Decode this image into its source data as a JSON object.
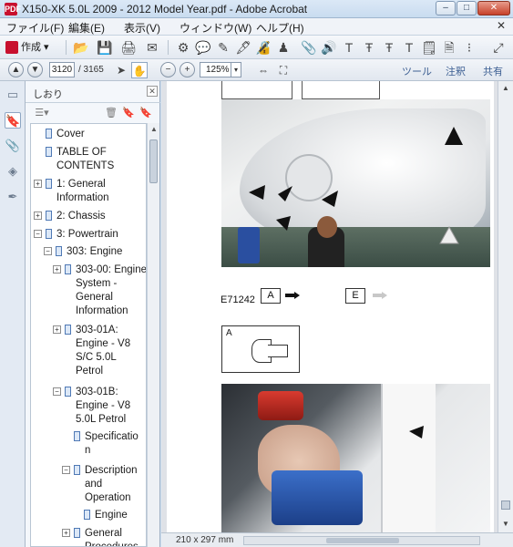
{
  "window": {
    "title": "X150-XK 5.0L 2009 - 2012 Model Year.pdf - Adobe Acrobat",
    "app_icon": "PDF",
    "buttons": {
      "minimize": "–",
      "maximize": "□",
      "close": "✕"
    }
  },
  "menu": {
    "items": [
      "ファイル(F)",
      "編集(E)",
      "表示(V)",
      "ウィンドウ(W)",
      "ヘルプ(H)"
    ],
    "close_glyph": "✕"
  },
  "toolbar": {
    "create_label": "作成 ▾"
  },
  "nav": {
    "current_page": "3120",
    "total_pages": "/ 3165",
    "zoom": "125%",
    "tabs": [
      "ツール",
      "注釈",
      "共有"
    ]
  },
  "bookmarks": {
    "title": "しおり",
    "close": "✕",
    "items": [
      {
        "label": "Cover"
      },
      {
        "label": "TABLE OF CONTENTS"
      },
      {
        "label": "1: General Information"
      },
      {
        "label": "2: Chassis"
      },
      {
        "label": "3: Powertrain"
      },
      {
        "label": "303: Engine"
      },
      {
        "label": "303-00: Engine System - General Information"
      },
      {
        "label": "303-01A: Engine - V8 S/C 5.0L Petrol"
      },
      {
        "label": "303-01B: Engine - V8 5.0L Petrol"
      },
      {
        "label": "Specification"
      },
      {
        "label": "Description and Operation"
      },
      {
        "label": "Engine"
      },
      {
        "label": "General Procedures"
      }
    ],
    "expanders": {
      "plus": "+",
      "minus": "−"
    }
  },
  "document": {
    "figure_code": "E71242",
    "legend": [
      "A",
      "E"
    ],
    "detail_label": "A"
  },
  "status": {
    "page_size": "210 x 297 mm"
  },
  "colors": {
    "title_bar": "#c9dcf0",
    "accent": "#3d5f93",
    "pdf_red": "#c8102e"
  }
}
